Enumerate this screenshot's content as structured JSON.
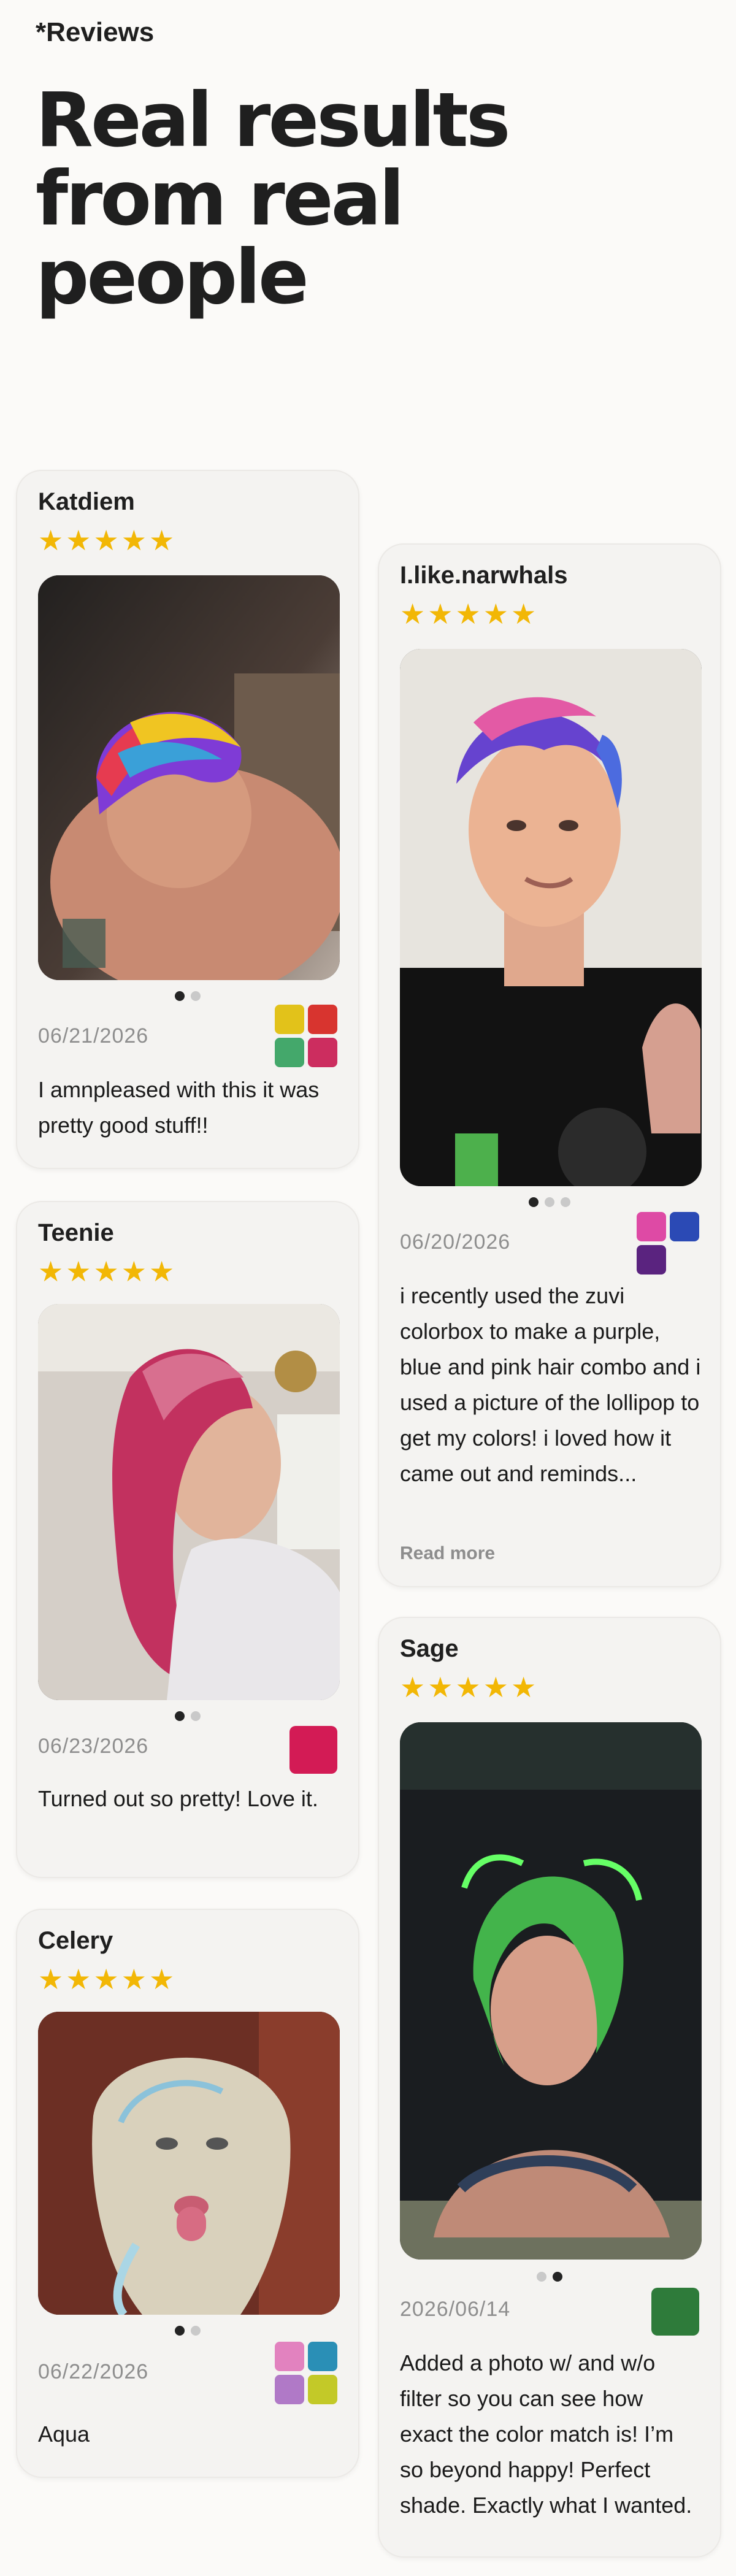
{
  "header": {
    "eyebrow": "*Reviews",
    "headline_lines": [
      "Real results",
      "from real",
      "people"
    ]
  },
  "colors": {
    "star": "#f2b705",
    "active_dot": "#242424",
    "inactive_dot": "#c9c9c9"
  },
  "reviews": [
    {
      "name": "Katdiem",
      "stars": "★★★★★",
      "date": "06/21/2026",
      "text": "I amnpleased with this it was pretty good stuff!!",
      "swatches": [
        "#e2c21a",
        "#d8342f",
        "#44a86b",
        "#cc2d5f"
      ]
    },
    {
      "name": "I.like.narwhals",
      "stars": "★★★★★",
      "date": "06/20/2026",
      "text": "i recently used the zuvi colorbox to make a purple, blue and pink hair combo and i used a picture of the lollipop to get my colors! i loved how it came out and reminds...",
      "read_more": "Read more",
      "swatches": [
        "#de4aa5",
        "#2b4ab5",
        "#5a237f"
      ]
    },
    {
      "name": "Teenie",
      "stars": "★★★★★",
      "date": "06/23/2026",
      "text": "Turned out so pretty! Love it.",
      "swatches": [
        "#d31b55"
      ]
    },
    {
      "name": "Sage",
      "stars": "★★★★★",
      "date": "2026/06/14",
      "text": "Added a photo w/ and w/o filter so you can see how exact the color match is! I’m so beyond happy! Perfect shade. Exactly what I wanted.",
      "swatches": [
        "#2e7b3a"
      ]
    },
    {
      "name": "Celery",
      "stars": "★★★★★",
      "date": "06/22/2026",
      "text": "Aqua",
      "swatches": [
        "#e282bf",
        "#2a8fb6",
        "#b079c7",
        "#c3c928"
      ]
    }
  ]
}
